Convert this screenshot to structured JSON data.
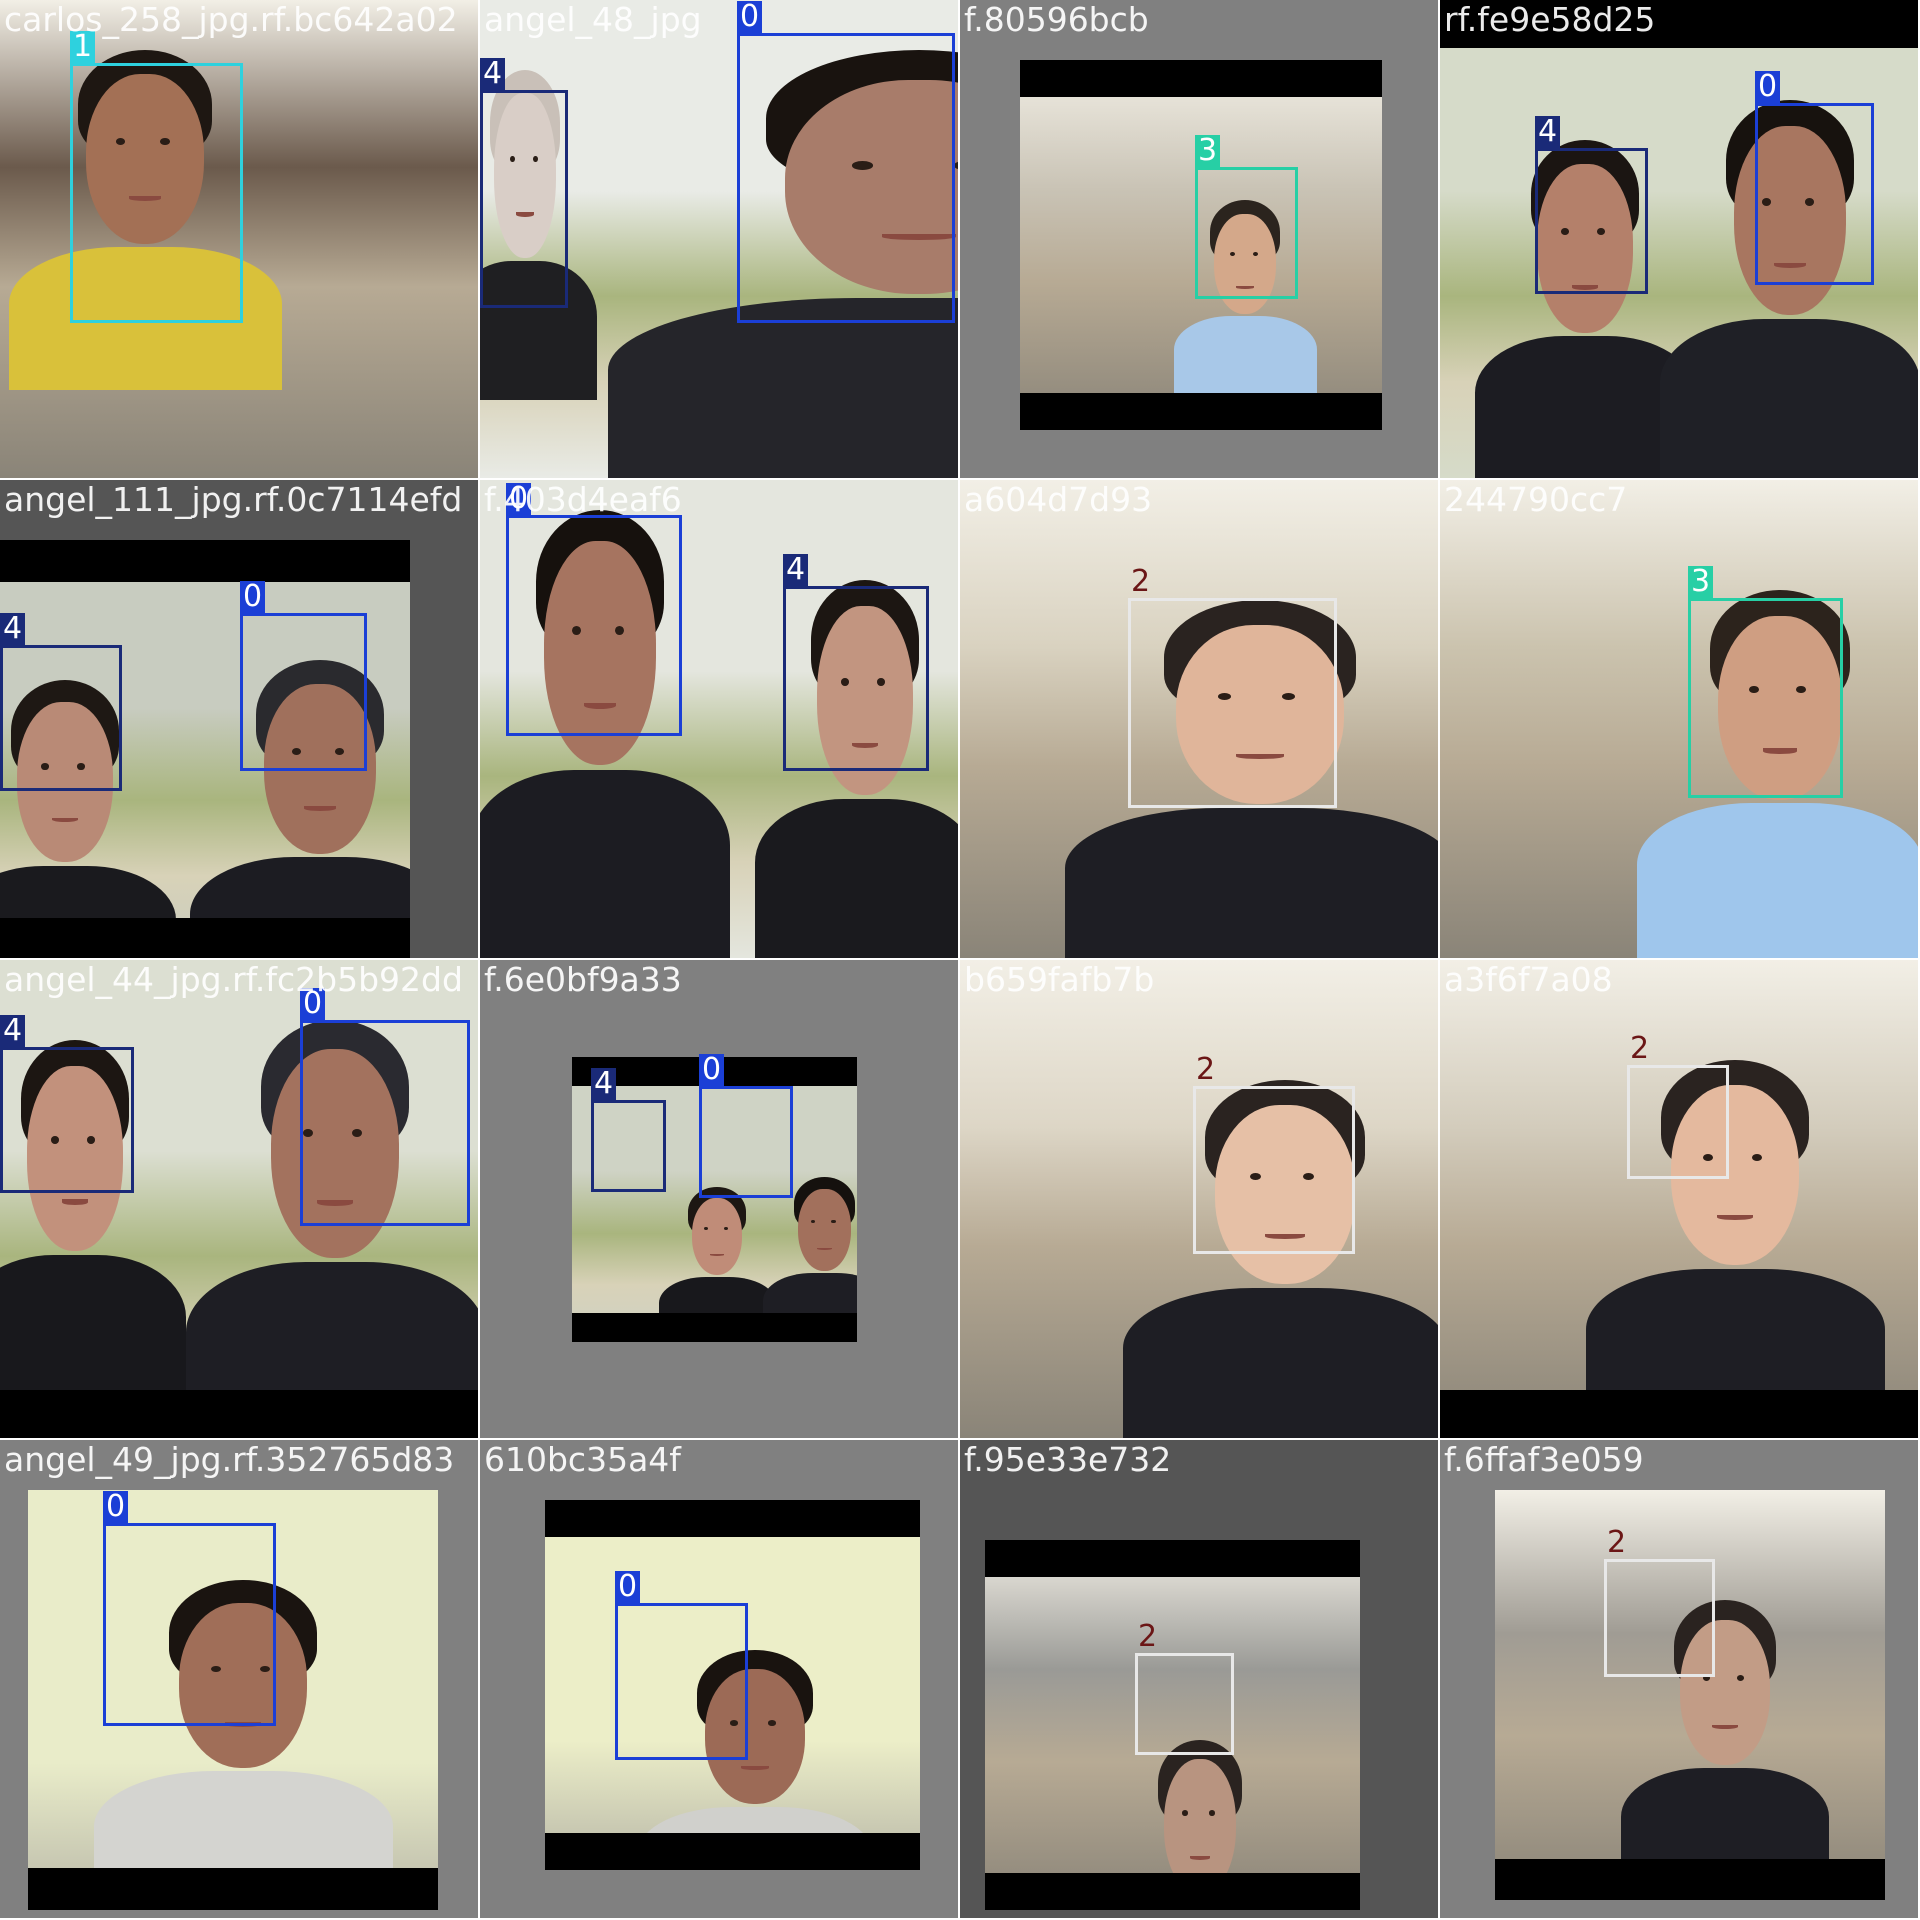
{
  "colors": {
    "class_0": "#1b3fd6",
    "class_1": "#2ed1de",
    "class_2_light": "#e8e8e8",
    "class_2_text": "#6b1616",
    "class_3": "#27cfa5",
    "class_4": "#1a2a78",
    "letterbox": "#808080",
    "letterbox_dark": "#555555",
    "bar": "#000000"
  },
  "tiles": [
    {
      "filename": "carlos_258_jpg.rf.bc642a02",
      "scene": "office",
      "photo": {
        "bg": "#6b5a4c"
      },
      "people": [
        {
          "skin": "#a37055",
          "hair": "#1e1712",
          "shirt": "#d9c13a"
        }
      ],
      "detections": [
        {
          "label": "1",
          "color_key": "class_1"
        }
      ]
    },
    {
      "filename": "angel_48_jpg",
      "scene": "outdoor",
      "photo": {
        "bg": "#e9ebe6"
      },
      "people": [
        {
          "skin": "#d9cec7",
          "hair": "#c9c0b8",
          "shirt": "#1f1f22"
        },
        {
          "skin": "#a87c6a",
          "hair": "#19130f",
          "shirt": "#25252a"
        }
      ],
      "detections": [
        {
          "label": "4",
          "color_key": "class_4"
        },
        {
          "label": "0",
          "color_key": "class_0"
        }
      ]
    },
    {
      "filename": "f.80596bcb",
      "scene": "office",
      "photo": {
        "bg": "#c9c3b5"
      },
      "people": [
        {
          "skin": "#d4a88a",
          "hair": "#2b241e",
          "shirt": "#a8c8e8"
        }
      ],
      "detections": [
        {
          "label": "3",
          "color_key": "class_3"
        }
      ]
    },
    {
      "filename": "rf.fe9e58d25",
      "scene": "outdoor",
      "photo": {
        "bg": "#d6dbc9"
      },
      "people": [
        {
          "skin": "#b4806a",
          "hair": "#1b1512",
          "shirt": "#1c1c22"
        },
        {
          "skin": "#a87660",
          "hair": "#17120e",
          "shirt": "#1f2026"
        }
      ],
      "detections": [
        {
          "label": "4",
          "color_key": "class_4"
        },
        {
          "label": "0",
          "color_key": "class_0"
        }
      ]
    },
    {
      "filename": "angel_111_jpg.rf.0c7114efd",
      "scene": "outdoor",
      "photo": {
        "bg": "#c8ccc0"
      },
      "people": [
        {
          "skin": "#b98a76",
          "hair": "#1e1814",
          "shirt": "#1a1a1e"
        },
        {
          "skin": "#a0705c",
          "hair": "#2a2a2e",
          "shirt": "#1c1c22"
        }
      ],
      "detections": [
        {
          "label": "4",
          "color_key": "class_4"
        },
        {
          "label": "0",
          "color_key": "class_0"
        }
      ]
    },
    {
      "filename": "f.403d4eaf6",
      "scene": "outdoor",
      "photo": {
        "bg": "#e4e6de"
      },
      "people": [
        {
          "skin": "#a67460",
          "hair": "#16110d",
          "shirt": "#1c1c22"
        },
        {
          "skin": "#c29580",
          "hair": "#1c1612",
          "shirt": "#1a1a1e"
        }
      ],
      "detections": [
        {
          "label": "0",
          "color_key": "class_0"
        },
        {
          "label": "4",
          "color_key": "class_4"
        }
      ]
    },
    {
      "filename": "a604d7d93",
      "scene": "office",
      "photo": {
        "bg": "#d9d2c0"
      },
      "people": [
        {
          "skin": "#e0b59a",
          "hair": "#2a2320",
          "shirt": "#1e1e24"
        }
      ],
      "detections": [
        {
          "label": "2",
          "color_key": "class_2_light"
        }
      ]
    },
    {
      "filename": "244790cc7",
      "scene": "office",
      "photo": {
        "bg": "#cbc3ae"
      },
      "people": [
        {
          "skin": "#cf9e82",
          "hair": "#2c231c",
          "shirt": "#9fc6ec"
        }
      ],
      "detections": [
        {
          "label": "3",
          "color_key": "class_3"
        }
      ]
    },
    {
      "filename": "angel_44_jpg.rf.fc2b5b92dd",
      "scene": "outdoor",
      "photo": {
        "bg": "#dcdfd2"
      },
      "people": [
        {
          "skin": "#c2917c",
          "hair": "#1c1612",
          "shirt": "#18181c"
        },
        {
          "skin": "#a3725e",
          "hair": "#2a2a30",
          "shirt": "#1e1e24"
        }
      ],
      "detections": [
        {
          "label": "4",
          "color_key": "class_4"
        },
        {
          "label": "0",
          "color_key": "class_0"
        }
      ]
    },
    {
      "filename": "f.6e0bf9a33",
      "scene": "outdoor",
      "photo": {
        "bg": "#cfd3c5"
      },
      "people": [
        {
          "skin": "#c08c78",
          "hair": "#1d1713",
          "shirt": "#18181c"
        },
        {
          "skin": "#a2705c",
          "hair": "#15110e",
          "shirt": "#1e1e24"
        }
      ],
      "detections": [
        {
          "label": "4",
          "color_key": "class_4"
        },
        {
          "label": "0",
          "color_key": "class_0"
        }
      ]
    },
    {
      "filename": "b659fafb7b",
      "scene": "office",
      "photo": {
        "bg": "#ddd6c6"
      },
      "people": [
        {
          "skin": "#e6c0a6",
          "hair": "#2a2320",
          "shirt": "#1e1e24"
        }
      ],
      "detections": [
        {
          "label": "2",
          "color_key": "class_2_light"
        }
      ]
    },
    {
      "filename": "a3f6f7a08",
      "scene": "office",
      "photo": {
        "bg": "#d3ccbc"
      },
      "people": [
        {
          "skin": "#e4b99e",
          "hair": "#2a2320",
          "shirt": "#1e1e24"
        }
      ],
      "detections": [
        {
          "label": "2",
          "color_key": "class_2_light"
        }
      ]
    },
    {
      "filename": "angel_49_jpg.rf.352765d83",
      "scene": "indoor",
      "photo": {
        "bg": "#e9ecc9"
      },
      "people": [
        {
          "skin": "#a06e58",
          "hair": "#1a1410",
          "shirt": "#d4d4d0"
        }
      ],
      "detections": [
        {
          "label": "0",
          "color_key": "class_0"
        }
      ]
    },
    {
      "filename": "610bc35a4f",
      "scene": "indoor",
      "photo": {
        "bg": "#eceec8"
      },
      "people": [
        {
          "skin": "#9c6a56",
          "hair": "#19130f",
          "shirt": "#d0d0cc"
        }
      ],
      "detections": [
        {
          "label": "0",
          "color_key": "class_0"
        }
      ]
    },
    {
      "filename": "f.95e33e732",
      "scene": "office",
      "photo": {
        "bg": "#9a9a96"
      },
      "people": [
        {
          "skin": "#b89480",
          "hair": "#2a2320",
          "shirt": "#1e1e24"
        }
      ],
      "detections": [
        {
          "label": "2",
          "color_key": "class_2_light"
        }
      ]
    },
    {
      "filename": "f.6ffaf3e059",
      "scene": "office",
      "photo": {
        "bg": "#a09c94"
      },
      "people": [
        {
          "skin": "#c29c86",
          "hair": "#2a2320",
          "shirt": "#1e1e24"
        }
      ],
      "detections": [
        {
          "label": "2",
          "color_key": "class_2_light"
        }
      ]
    }
  ]
}
